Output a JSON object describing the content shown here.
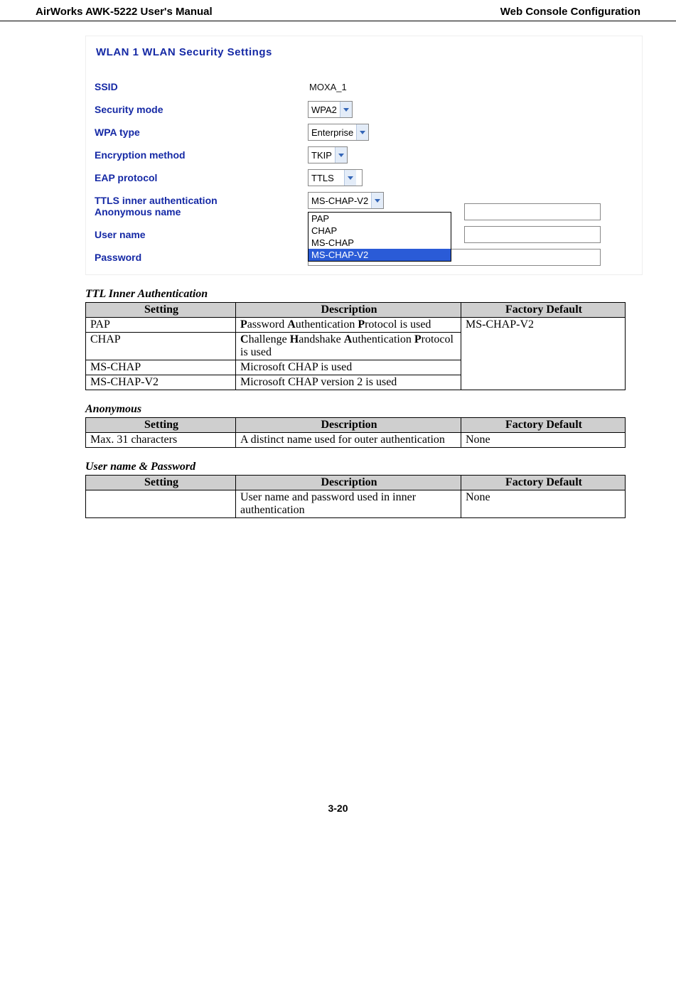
{
  "header": {
    "left": "AirWorks AWK-5222 User's Manual",
    "right": "Web Console Configuration"
  },
  "screenshot": {
    "title": "WLAN 1  WLAN Security Settings",
    "rows": {
      "ssid_label": "SSID",
      "ssid_value": "MOXA_1",
      "secmode_label": "Security mode",
      "secmode_value": "WPA2",
      "wpatype_label": "WPA type",
      "wpatype_value": "Enterprise",
      "enc_label": "Encryption method",
      "enc_value": "TKIP",
      "eap_label": "EAP protocol",
      "eap_value": "TTLS",
      "ttls_label": "TTLS inner authentication",
      "ttls_value": "MS-CHAP-V2",
      "anon_label": "Anonymous name",
      "user_label": "User name",
      "pwd_label": "Password"
    },
    "dropdown_options": {
      "o0": "PAP",
      "o1": "CHAP",
      "o2": "MS-CHAP",
      "o3": "MS-CHAP-V2"
    }
  },
  "tables": {
    "ttl": {
      "caption": "TTL Inner Authentication",
      "h0": "Setting",
      "h1": "Description",
      "h2": "Factory Default",
      "r0c0": "PAP",
      "r0c1": "Password Authentication Protocol is used",
      "r0c2": "MS-CHAP-V2",
      "r1c0": "CHAP",
      "r1c1": "Challenge Handshake Authentication Protocol is used",
      "r2c0": "MS-CHAP",
      "r2c1": "Microsoft CHAP is used",
      "r3c0": "MS-CHAP-V2",
      "r3c1": "Microsoft CHAP version 2 is used"
    },
    "anon": {
      "caption": "Anonymous",
      "h0": "Setting",
      "h1": "Description",
      "h2": "Factory Default",
      "r0c0": "Max. 31 characters",
      "r0c1": "A distinct name used for outer authentication",
      "r0c2": "None"
    },
    "user": {
      "caption": "User name & Password",
      "h0": "Setting",
      "h1": "Description",
      "h2": "Factory Default",
      "r0c0": "",
      "r0c1": "User name and password used in inner authentication",
      "r0c2": "None"
    }
  },
  "pagenum": "3-20"
}
